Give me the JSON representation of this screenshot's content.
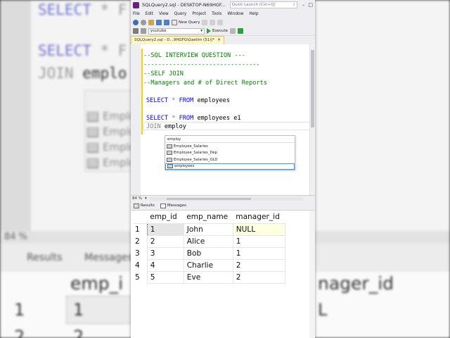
{
  "window": {
    "title": "SQLQuery2.sql - DESKTOP-N69HGF...",
    "quick_launch_placeholder": "Quick Launch (Ctrl+Q)",
    "doc_tab": "SQLQuery2.sql - D...9HGFG\\Gaelim (51))*"
  },
  "menu": [
    "File",
    "Edit",
    "View",
    "Query",
    "Project",
    "Tools",
    "Window",
    "Help"
  ],
  "toolbar": {
    "new_query_label": "New Query",
    "database_value": "youtube",
    "execute_label": "Execute"
  },
  "editor": {
    "lines": [
      "--SQL INTERVIEW QUESTION ---",
      "--------------------------------",
      "--SELF JOIN",
      "--Managers and # of Direct Reports"
    ],
    "query1": {
      "kw1": "SELECT",
      "star": " * ",
      "kw2": "FROM",
      "tbl": " employees"
    },
    "query2": {
      "kw1": "SELECT",
      "star": " * ",
      "kw2": "FROM",
      "tbl": " employees e1"
    },
    "query3": {
      "kw1": "JOIN",
      "tbl": " employ"
    },
    "zoom": "84 %"
  },
  "intellisense": {
    "typed": "employ",
    "items": [
      "Employee_Salaries",
      "Employee_Salaries_Dep",
      "Employee_Salaries_OLD",
      "employees"
    ],
    "selected_index": 3
  },
  "result_tabs": {
    "results": "Results",
    "messages": "Messages"
  },
  "results_grid": {
    "columns": [
      "emp_id",
      "emp_name",
      "manager_id"
    ],
    "rows": [
      {
        "n": "1",
        "emp_id": "1",
        "emp_name": "John",
        "manager_id": "NULL"
      },
      {
        "n": "2",
        "emp_id": "2",
        "emp_name": "Alice",
        "manager_id": "1"
      },
      {
        "n": "3",
        "emp_id": "3",
        "emp_name": "Bob",
        "manager_id": "1"
      },
      {
        "n": "4",
        "emp_id": "4",
        "emp_name": "Charlie",
        "manager_id": "2"
      },
      {
        "n": "5",
        "emp_id": "5",
        "emp_name": "Eve",
        "manager_id": "2"
      }
    ]
  },
  "background": {
    "code_select": "SELECT",
    "code_star": "* F",
    "code_join": "JOIN",
    "code_emplo": "emplo",
    "row_label": "Emplo",
    "zoom": "84 %",
    "results_tab": "Results",
    "messages_tab": "Messages",
    "col_head_left": "emp_i",
    "col_head_right": "nager_id",
    "cell_rownum": "1",
    "cell_val": "1",
    "cell_right": "L",
    "row2_num": "2",
    "row2_val": "2"
  }
}
